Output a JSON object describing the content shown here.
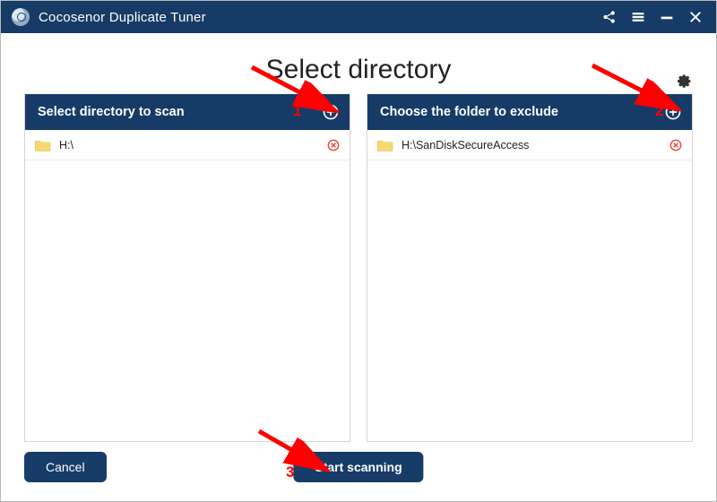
{
  "app_title": "Cocosenor Duplicate Tuner",
  "page_title": "Select directory",
  "panels": {
    "scan": {
      "header": "Select directory to scan",
      "items": [
        {
          "path": "H:\\"
        }
      ]
    },
    "exclude": {
      "header": "Choose the folder to exclude",
      "items": [
        {
          "path": "H:\\SanDiskSecureAccess"
        }
      ]
    }
  },
  "buttons": {
    "cancel": "Cancel",
    "start": "Start scanning"
  },
  "annotations": {
    "n1": "1",
    "n2": "2",
    "n3": "3"
  },
  "colors": {
    "brand": "#163b66",
    "accent_red": "#ff0000",
    "remove": "#e44a3a"
  }
}
